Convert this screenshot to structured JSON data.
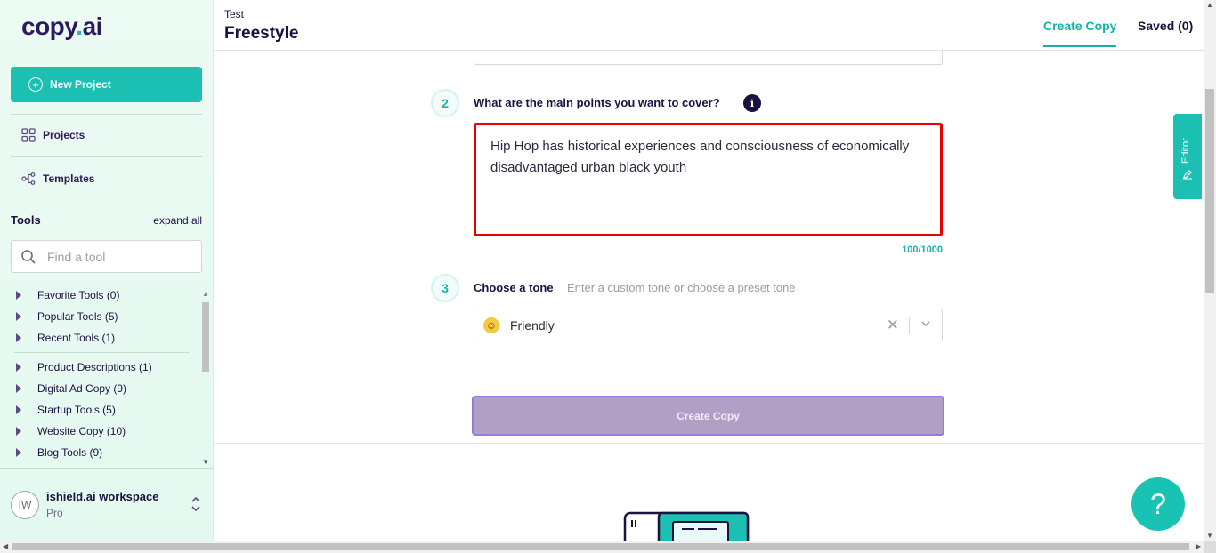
{
  "sidebar": {
    "logo": {
      "text_a": "copy",
      "dot": ".",
      "text_b": "ai"
    },
    "new_project": "New Project",
    "nav": {
      "projects": "Projects",
      "templates": "Templates"
    },
    "tools_title": "Tools",
    "expand_all": "expand all",
    "search_placeholder": "Find a tool",
    "tool_groups": [
      "Favorite Tools (0)",
      "Popular Tools (5)",
      "Recent Tools (1)",
      "Product Descriptions (1)",
      "Digital Ad Copy (9)",
      "Startup Tools (5)",
      "Website Copy (10)",
      "Blog Tools (9)"
    ],
    "workspace": {
      "initials": "IW",
      "name": "ishield.ai workspace",
      "plan": "Pro"
    }
  },
  "header": {
    "breadcrumb": "Test",
    "title": "Freestyle",
    "tabs": {
      "create": "Create Copy",
      "saved": "Saved (0)"
    }
  },
  "form": {
    "step2": {
      "number": "2",
      "question": "What are the main points you want to cover?",
      "info": "i",
      "value": "Hip Hop has historical experiences and consciousness of economically disadvantaged urban black youth",
      "counter": "100/1000"
    },
    "step3": {
      "number": "3",
      "question": "Choose a tone",
      "hint": "Enter a custom tone or choose a preset tone",
      "selected": "Friendly",
      "clear": "✕",
      "chevron": "⌄"
    },
    "submit": "Create Copy"
  },
  "editor_tab": "Editor",
  "help": "?",
  "colors": {
    "accent": "#1cc0b2",
    "brand_text": "#1d1140",
    "highlight_border": "#e60000",
    "button_disabled": "#b29fc6"
  }
}
